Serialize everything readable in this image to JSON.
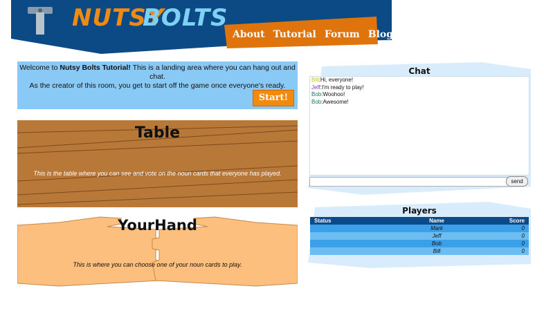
{
  "header": {
    "logo_word1": "NUTSY",
    "logo_word2": "BOLTS",
    "nav": [
      "About",
      "Tutorial",
      "Forum",
      "Blog"
    ],
    "colors": {
      "navy": "#0c4a86",
      "orange": "#e0740c"
    }
  },
  "welcome": {
    "lead": "Welcome to ",
    "room_name": "Nutsy Bolts Tutorial!",
    "line1_rest": " This is a landing area where you can hang out and chat.",
    "line2": "As the creator of this room, you get to start off the game once everyone's ready.",
    "start_label": "Start!"
  },
  "table": {
    "title": "Table",
    "description": "This is the table where you can see and vote on the noun cards that everyone has played."
  },
  "hand": {
    "title": "YourHand",
    "description": "This is where you can choose one of your noun cards to play."
  },
  "chat": {
    "title": "Chat",
    "messages": [
      {
        "user": "Bill",
        "text": "Hi, everyone!",
        "color": "#c8c800"
      },
      {
        "user": "Jeff",
        "text": "I'm ready to play!",
        "color": "#7a3fbf"
      },
      {
        "user": "Bob",
        "text": "Woohoo!",
        "color": "#1a7a5a"
      },
      {
        "user": "Bob",
        "text": "Awesome!",
        "color": "#1a7a5a"
      }
    ],
    "input_value": "",
    "send_label": "send"
  },
  "players": {
    "title": "Players",
    "columns": [
      "Status",
      "Name",
      "Score"
    ],
    "rows": [
      {
        "status": "",
        "name": "Mark",
        "score": "0"
      },
      {
        "status": "",
        "name": "Jeff",
        "score": "0"
      },
      {
        "status": "",
        "name": "Bob",
        "score": "0"
      },
      {
        "status": "",
        "name": "Bill",
        "score": "0"
      }
    ]
  }
}
